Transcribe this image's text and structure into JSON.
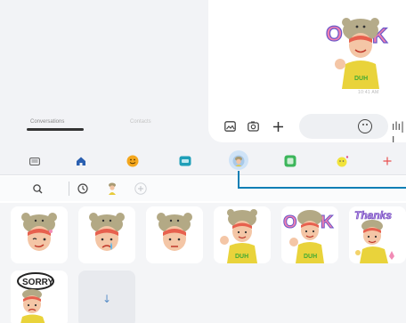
{
  "tabs": {
    "conversations": "Conversations",
    "contacts": "Contacts"
  },
  "chat": {
    "timestamp": "10:41 AM"
  },
  "composer": {
    "voice": "ılı|ı"
  },
  "categories": [
    {
      "icon": "keyboard-icon"
    },
    {
      "icon": "home-icon"
    },
    {
      "icon": "emoji-icon"
    },
    {
      "icon": "gif-icon"
    },
    {
      "icon": "ar-emoji-icon",
      "selected": true
    },
    {
      "icon": "sticker-icon"
    },
    {
      "icon": "bitmoji-icon"
    },
    {
      "icon": "add-icon"
    }
  ],
  "download_tile": {
    "icon": "download-icon",
    "glyph": "↓"
  },
  "colors": {
    "accent": "#0c7fb5",
    "add": "#e8504f",
    "background": "#f2f3f6"
  }
}
